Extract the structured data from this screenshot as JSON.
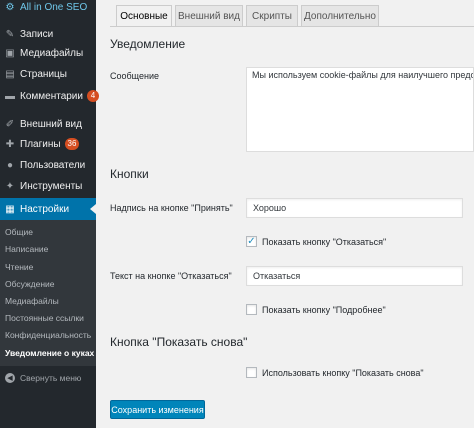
{
  "sidebar": {
    "top_item": "All in One SEO",
    "items": [
      {
        "label": "Записи",
        "icon": "pushpin-icon"
      },
      {
        "label": "Медиафайлы",
        "icon": "media-icon"
      },
      {
        "label": "Страницы",
        "icon": "pages-icon"
      },
      {
        "label": "Комментарии",
        "icon": "comments-icon",
        "badge": "4"
      },
      {
        "label": "Внешний вид",
        "icon": "appearance-icon"
      },
      {
        "label": "Плагины",
        "icon": "plugins-icon",
        "badge": "36"
      },
      {
        "label": "Пользователи",
        "icon": "users-icon"
      },
      {
        "label": "Инструменты",
        "icon": "tools-icon"
      },
      {
        "label": "Настройки",
        "icon": "settings-icon",
        "active": true
      }
    ],
    "submenu": [
      "Общие",
      "Написание",
      "Чтение",
      "Обсуждение",
      "Медиафайлы",
      "Постоянные ссылки",
      "Конфиденциальность",
      "Уведомление о куках"
    ],
    "collapse_label": "Свернуть меню"
  },
  "tabs": [
    "Основные",
    "Внешний вид",
    "Скрипты",
    "Дополнительно"
  ],
  "form": {
    "notice_title": "Уведомление",
    "message_label": "Сообщение",
    "message_value": "Мы используем cookie-файлы для наилучшего представ",
    "buttons_title": "Кнопки",
    "accept_label": "Надпись на кнопке \"Принять\"",
    "accept_value": "Хорошо",
    "show_reject_label": "Показать кнопку \"Отказаться\"",
    "show_reject_checked": true,
    "reject_label": "Текст на кнопке \"Отказаться\"",
    "reject_value": "Отказаться",
    "show_more_label": "Показать кнопку \"Подробнее\"",
    "show_more_checked": false,
    "show_again_title": "Кнопка \"Показать снова\"",
    "use_show_again_label": "Использовать кнопку \"Показать снова\"",
    "use_show_again_checked": false,
    "save_label": "Сохранить изменения"
  },
  "colors": {
    "sidebar": "#23282d",
    "active": "#0073aa",
    "primary_button": "#0085ba",
    "badge": "#d54e21"
  }
}
